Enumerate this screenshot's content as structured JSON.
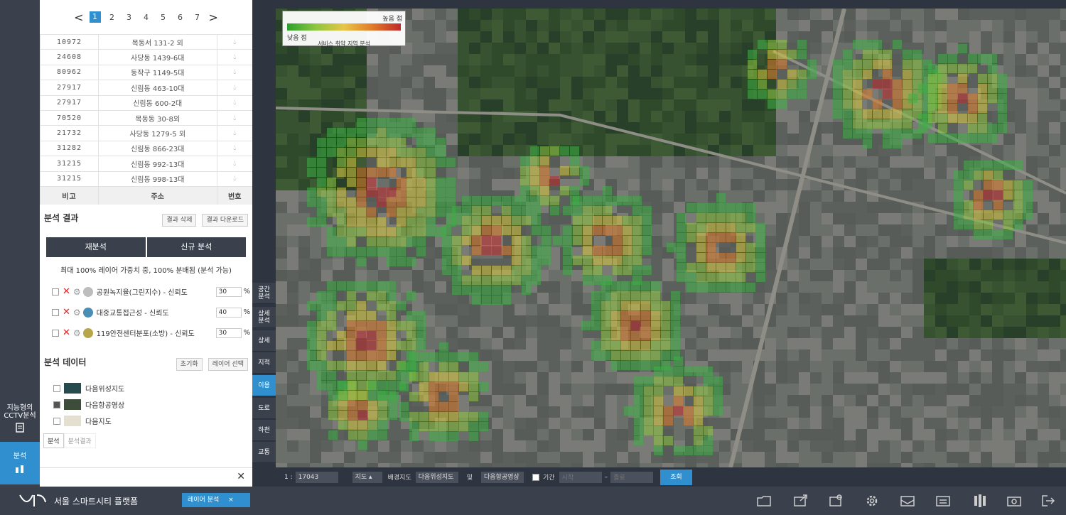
{
  "pager": {
    "prev": "<",
    "next": ">",
    "pages": [
      "1",
      "2",
      "3",
      "4",
      "5",
      "6",
      "7"
    ],
    "current": "1"
  },
  "results": {
    "headers": [
      "번호",
      "주소",
      "비고"
    ],
    "rows": [
      {
        "id": "10972",
        "addr": "목동서 131-2 외"
      },
      {
        "id": "24608",
        "addr": "사당동 1439-6대"
      },
      {
        "id": "80962",
        "addr": "동작구 1149-5대"
      },
      {
        "id": "27917",
        "addr": "신림동 463-10대"
      },
      {
        "id": "27917",
        "addr": "신림동 600-2대"
      },
      {
        "id": "70520",
        "addr": "목동동 30-8외"
      },
      {
        "id": "21732",
        "addr": "사당동 1279-5 외"
      },
      {
        "id": "31282",
        "addr": "신림동 866-23대"
      },
      {
        "id": "31215",
        "addr": "신림동 992-13대"
      },
      {
        "id": "31215",
        "addr": "신림동 998-13대"
      }
    ]
  },
  "analysis": {
    "title": "분석 결과",
    "btn_download": "결과 다운로드",
    "btn_clear": "결과 삭제",
    "mode_left": "재분석",
    "mode_right": "신규 분석",
    "note": "최대 100% 레이어 가중치 중, 100% 분배됨 (분석 가능)",
    "layers": [
      {
        "name": "공원녹지율(그린지수) - 신뢰도",
        "pct": "30",
        "color": "#bdbdbd"
      },
      {
        "name": "대중교통접근성 - 신뢰도",
        "pct": "40",
        "color": "#4a8db5"
      },
      {
        "name": "119안전센터분포(소방) - 신뢰도",
        "pct": "30",
        "color": "#b8a64a"
      }
    ],
    "pct_sign": "%"
  },
  "base": {
    "title": "분석 데이터",
    "btn_layer": "레이어 선택",
    "btn_reset": "초기화",
    "maps": [
      {
        "name": "다음위성지도",
        "checked": false
      },
      {
        "name": "다음항공영상",
        "checked": true
      },
      {
        "name": "다음지도",
        "checked": false
      }
    ]
  },
  "panel_tabs": [
    "분석",
    "분석결과"
  ],
  "rail": {
    "cctv": "지능형의\nCCTV분석",
    "analysis": "분석"
  },
  "vtabs": [
    "공간\n분석",
    "상세\n분석",
    "상세",
    "지적",
    "이용",
    "도로",
    "하천",
    "교통"
  ],
  "legend": {
    "high": "높음 점",
    "low": "낮음 점",
    "caption": "서비스 취약 지역 분석"
  },
  "mapbar": {
    "scale_label": "1 :",
    "scale_value": "17043",
    "type_label": "지도",
    "basemap_label": "배경지도",
    "basemap_value": "다음위성지도",
    "overlay_label": "및",
    "overlay_value": "다음항공영상",
    "date_label": "기간",
    "from_placeholder": "시작",
    "to_placeholder": "종료",
    "search_btn": "조회"
  },
  "app": {
    "title": "서울 스마트시티 플랫폼",
    "status_tab": "레이어 분석",
    "status_close": "×"
  },
  "colors": {
    "accent": "#2f8fcf",
    "dark": "#3a404c"
  }
}
